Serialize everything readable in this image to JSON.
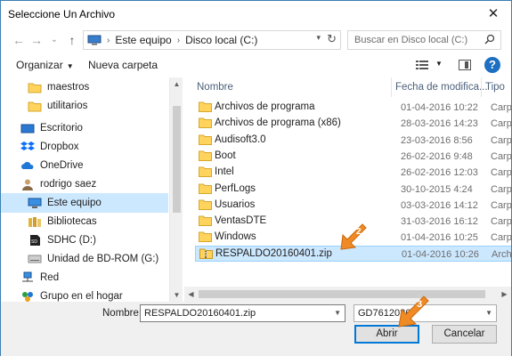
{
  "window": {
    "title": "Seleccione Un Archivo",
    "close_glyph": "✕"
  },
  "nav": {
    "back": "←",
    "forward": "→",
    "recent": "⌄",
    "up": "↑"
  },
  "address": {
    "crumbs": [
      "Este equipo",
      "Disco local (C:)"
    ],
    "search_placeholder": "Buscar en Disco local (C:)"
  },
  "toolbar": {
    "organize": "Organizar",
    "new_folder": "Nueva carpeta",
    "help": "?"
  },
  "sidebar": {
    "items": [
      {
        "label": "maestros",
        "icon": "folder-icon"
      },
      {
        "label": "utilitarios",
        "icon": "folder-icon"
      },
      {
        "label": "Escritorio",
        "icon": "desktop-icon"
      },
      {
        "label": "Dropbox",
        "icon": "dropbox-icon"
      },
      {
        "label": "OneDrive",
        "icon": "onedrive-icon"
      },
      {
        "label": "rodrigo saez",
        "icon": "user-icon"
      },
      {
        "label": "Este equipo",
        "icon": "computer-icon",
        "selected": true
      },
      {
        "label": "Bibliotecas",
        "icon": "libraries-icon"
      },
      {
        "label": "SDHC (D:)",
        "icon": "sd-card-icon"
      },
      {
        "label": "Unidad de BD-ROM (G:)",
        "icon": "optical-drive-icon"
      },
      {
        "label": "Red",
        "icon": "network-icon"
      },
      {
        "label": "Grupo en el hogar",
        "icon": "homegroup-icon"
      }
    ]
  },
  "columns": {
    "name": "Nombre",
    "date": "Fecha de modifica...",
    "type": "Tipo"
  },
  "files": [
    {
      "name": "Archivos de programa",
      "date": "01-04-2016 10:22",
      "type": "Carpe",
      "icon": "folder-icon"
    },
    {
      "name": "Archivos de programa (x86)",
      "date": "28-03-2016 14:23",
      "type": "Carpe",
      "icon": "folder-icon"
    },
    {
      "name": "Audisoft3.0",
      "date": "23-03-2016 8:56",
      "type": "Carpe",
      "icon": "folder-icon"
    },
    {
      "name": "Boot",
      "date": "26-02-2016 9:48",
      "type": "Carpe",
      "icon": "folder-icon"
    },
    {
      "name": "Intel",
      "date": "26-02-2016 12:03",
      "type": "Carpe",
      "icon": "folder-icon"
    },
    {
      "name": "PerfLogs",
      "date": "30-10-2015 4:24",
      "type": "Carpe",
      "icon": "folder-icon"
    },
    {
      "name": "Usuarios",
      "date": "03-03-2016 14:12",
      "type": "Carpe",
      "icon": "folder-icon"
    },
    {
      "name": "VentasDTE",
      "date": "31-03-2016 16:12",
      "type": "Carpe",
      "icon": "folder-icon"
    },
    {
      "name": "Windows",
      "date": "01-04-2016 10:25",
      "type": "Carpe",
      "icon": "folder-icon"
    },
    {
      "name": "RESPALDO20160401.zip",
      "date": "01-04-2016 10:26",
      "type": "Archi",
      "icon": "zip-file-icon",
      "selected": true
    }
  ],
  "footer": {
    "name_label": "Nombre:",
    "name_value": "RESPALDO20160401.zip",
    "filter_value": "GD7612026",
    "open_label": "Abrir",
    "cancel_label": "Cancelar"
  },
  "annotations": {
    "step2": "2",
    "step3": "3"
  },
  "colors": {
    "accent": "#0078d7",
    "selection": "#cce8ff",
    "folder": "#ffd35c",
    "annotation": "#f08a24"
  }
}
